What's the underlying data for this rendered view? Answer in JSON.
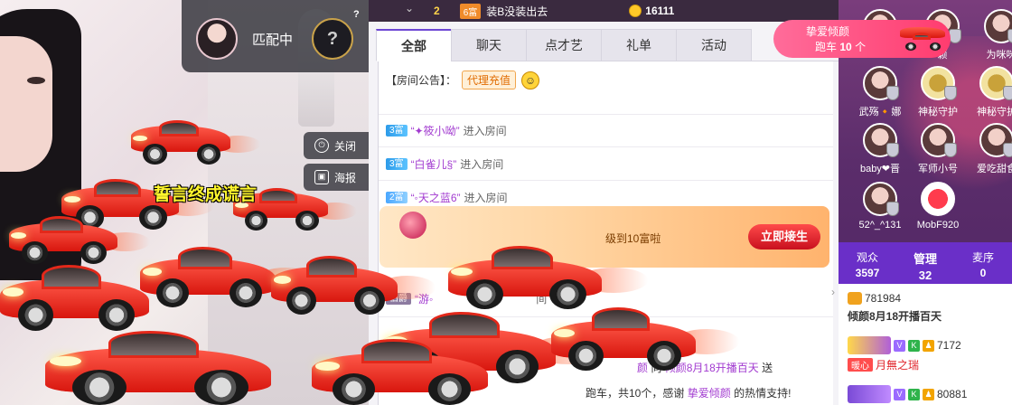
{
  "match": {
    "status": "匹配中",
    "slot_placeholder": "?",
    "help": "?"
  },
  "video_controls": {
    "close_label": "关闭",
    "poster_label": "海报"
  },
  "lyric": "誓言终成谎言",
  "top_strip": {
    "level": "2",
    "rich_badge": "6富",
    "message": "装B没装出去",
    "coin_value": "16111"
  },
  "tabs": [
    "全部",
    "聊天",
    "点才艺",
    "礼单",
    "活动"
  ],
  "notice": {
    "label": "【房间公告】：",
    "tag": "代理充值"
  },
  "chat": [
    {
      "rich": "3富",
      "user": "“✦筱小呦”",
      "action": "进入房间"
    },
    {
      "rich": "3富",
      "user": "“白雀儿§”",
      "action": "进入房间"
    },
    {
      "rich": "2富",
      "user": "“◦天之蓝6”",
      "action": "进入房间"
    }
  ],
  "banner": {
    "text": "级到10富啦",
    "button": "立即接生"
  },
  "partial_line": {
    "badge": "伯爵",
    "user": "“游◦",
    "action": "间"
  },
  "gift_line": {
    "from": "颜",
    "to_label": "向",
    "target": "倾颜8月18开播百天",
    "verb": "送"
  },
  "thanks_line": {
    "prefix": "跑车，共10个，感谢",
    "user": "挚爱倾颜",
    "suffix": "的热情支持!"
  },
  "car_badge": {
    "title": "挚爱倾颜",
    "item": "跑车",
    "count": "10",
    "unit": "个"
  },
  "vips": [
    {
      "name": ""
    },
    {
      "name": "颖"
    },
    {
      "name": "为咪咪"
    },
    {
      "name": "武殇🔸娜"
    },
    {
      "name": "神秘守护"
    },
    {
      "name": "神秘守护"
    },
    {
      "name": "baby❤晋"
    },
    {
      "name": "军师小号"
    },
    {
      "name": "爱吃甜食"
    },
    {
      "name": "52^_^131"
    },
    {
      "name": "MobF920"
    }
  ],
  "stats": {
    "audience_label": "观众",
    "audience_value": "3597",
    "admin_label": "管理",
    "admin_value": "32",
    "queue_label": "麦序",
    "queue_value": "0"
  },
  "right_chat": {
    "line1_value": "781984",
    "line1_text": "倾颜8月18开播百天",
    "line2_value": "7172",
    "line2_tag": "暖心",
    "line2_name": "月無之瑞",
    "line3_value": "80881"
  },
  "colors": {
    "accent_purple": "#6d47d4",
    "rich_blue": "#2d9be9",
    "banner_button": "#c8101e",
    "car_red": "#e3281a"
  }
}
